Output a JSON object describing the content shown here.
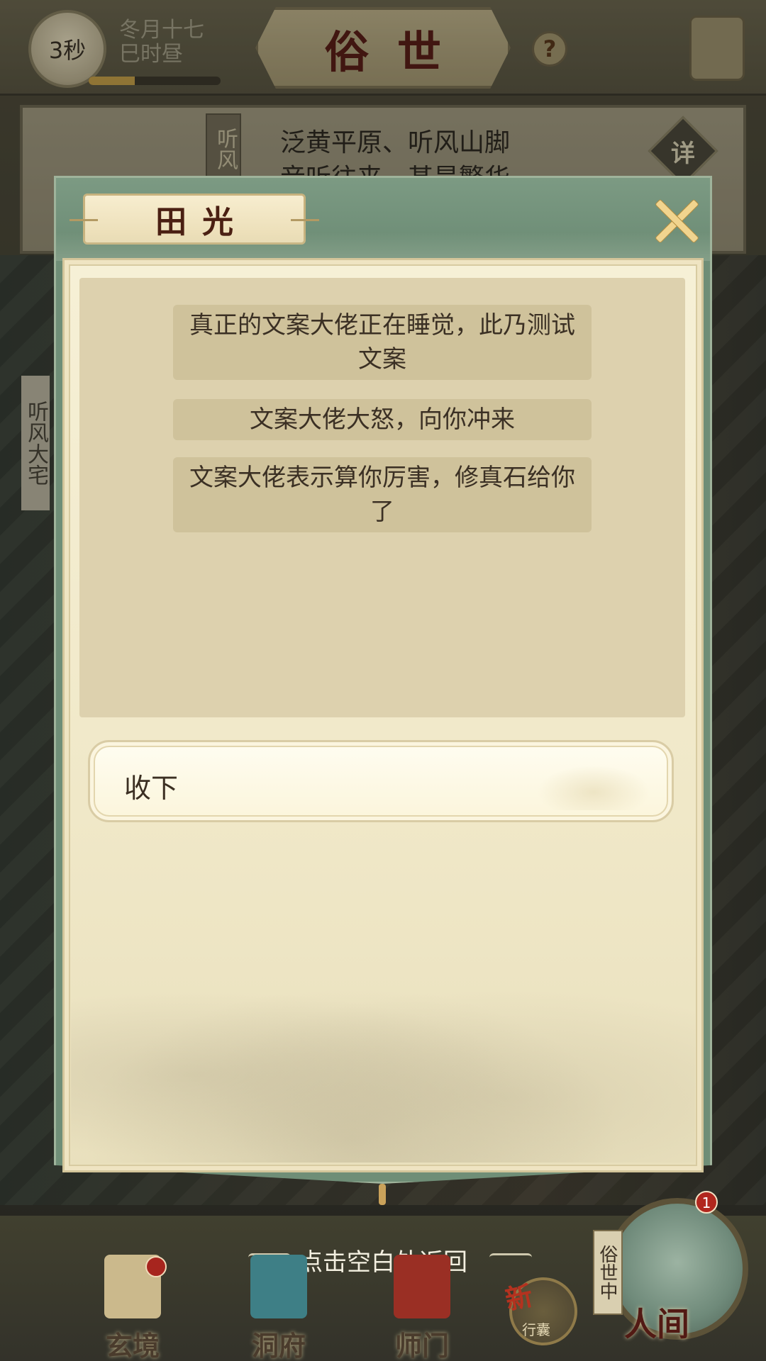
{
  "top_bar": {
    "timer_text": "3秒",
    "date_line1": "冬月十七",
    "date_line2": "巳时昼",
    "time_progress": 0.35,
    "title": "俗世",
    "help_label": "?"
  },
  "location": {
    "sign_text": "听风",
    "line1": "泛黄平原、听风山脚",
    "line2": "音听往来，甚是繁华",
    "detail_label": "详"
  },
  "side_sign": "听风大宅",
  "dialog": {
    "npc_name": "田光",
    "log_lines": [
      "真正的文案大佬正在睡觉，此乃测试文案",
      "文案大佬大怒，向你冲来",
      "文案大佬表示算你厉害，修真石给你了"
    ],
    "choice_label": "收下"
  },
  "bottom": {
    "back_hint": "点击空白处返回",
    "nav": [
      {
        "label": "玄境",
        "icon": "scroll-icon",
        "color": "#cbb98c"
      },
      {
        "label": "洞府",
        "icon": "pavilion-icon",
        "color": "#3e7f86"
      },
      {
        "label": "师门",
        "icon": "sect-icon",
        "color": "#9a2f24"
      }
    ],
    "bag_new": "新",
    "bag_label": "行囊",
    "world_tag": "俗世中",
    "world_label": "人间",
    "world_badge": "1"
  }
}
